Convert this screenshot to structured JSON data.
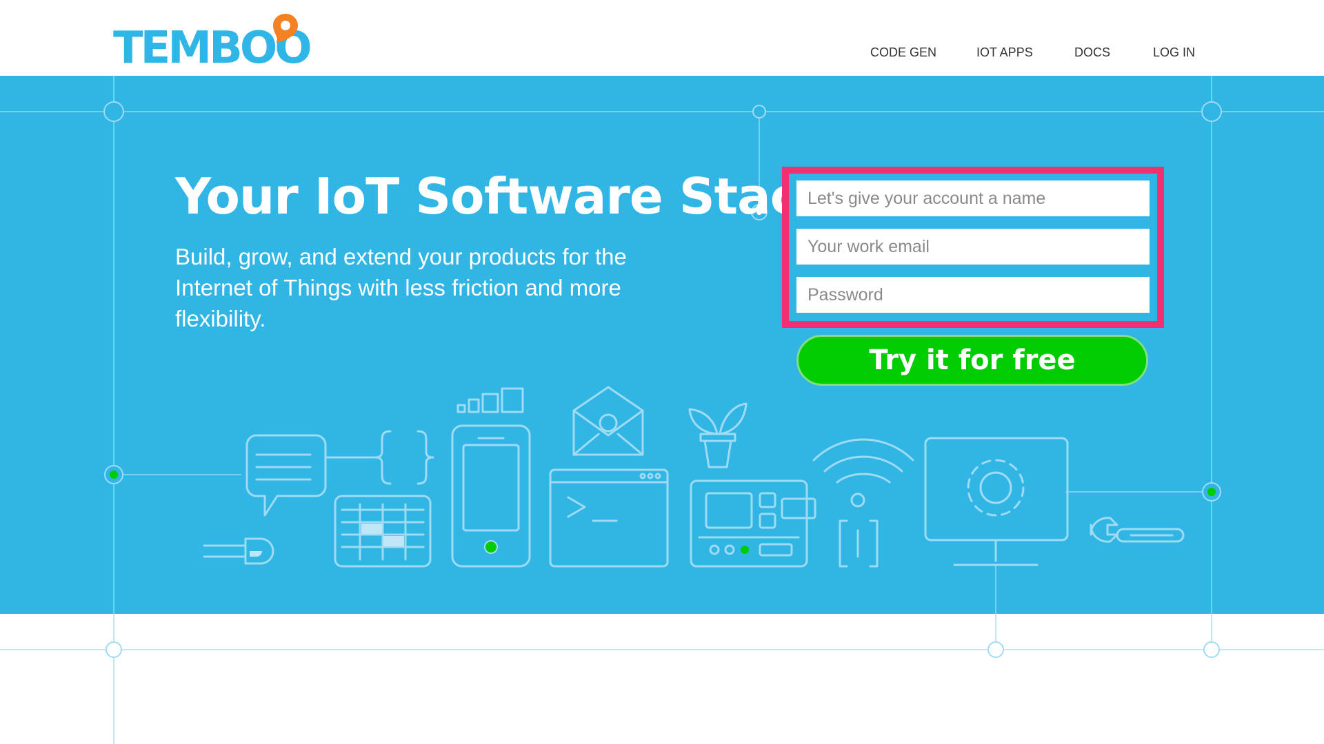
{
  "brand": {
    "logo_text": "TEMBOO",
    "logo_color": "#2fb5e6",
    "pin_color": "#f58220"
  },
  "nav": {
    "items": [
      {
        "label": "CODE GEN"
      },
      {
        "label": "IOT APPS"
      },
      {
        "label": "DOCS"
      },
      {
        "label": "LOG IN"
      }
    ]
  },
  "hero": {
    "headline": "Your IoT Software Stack",
    "subtext": "Build, grow, and extend your products for the Internet of Things with less friction and more flexibility.",
    "background": "#31b5e5"
  },
  "signup": {
    "account_name_placeholder": "Let's give your account a name",
    "email_placeholder": "Your work email",
    "password_placeholder": "Password",
    "submit_label": "Try it for free",
    "highlight_color": "#f22f70",
    "button_color": "#00cc00"
  },
  "illustration": {
    "icons": [
      "speech-bubble-icon",
      "code-braces-icon",
      "led-icon",
      "keypad-icon",
      "smartphone-icon",
      "signal-bars-icon",
      "email-icon",
      "terminal-window-icon",
      "plant-icon",
      "control-board-icon",
      "wifi-sensor-icon",
      "monitor-gear-icon",
      "wrench-icon"
    ]
  }
}
